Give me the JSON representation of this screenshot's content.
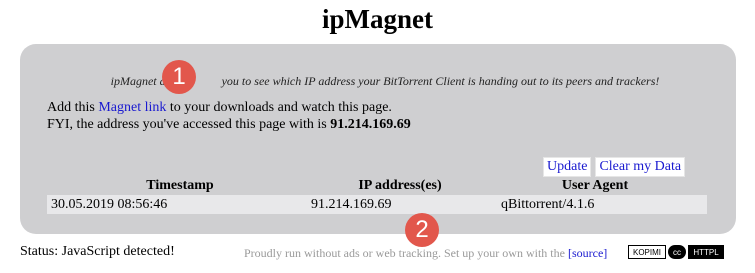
{
  "page": {
    "title": "ipMagnet",
    "tagline_left": "ipMagnet a",
    "tagline_right": "you to see which IP address your BitTorrent Client is handing out to its peers and trackers!",
    "add_prefix": "Add this ",
    "magnet_link": "Magnet link",
    "add_suffix": " to your downloads and watch this page.",
    "fyi_prefix": "FYI, the address you've accessed this page with is ",
    "fyi_ip": "91.214.169.69"
  },
  "buttons": {
    "update": "Update",
    "clear": "Clear my Data"
  },
  "table": {
    "headers": [
      "Timestamp",
      "IP address(es)",
      "User Agent"
    ],
    "rows": [
      [
        "30.05.2019 08:56:46",
        "91.214.169.69",
        "qBittorrent/4.1.6"
      ]
    ]
  },
  "markers": [
    "1",
    "2"
  ],
  "status": "Status: JavaScript detected!",
  "footer": {
    "text": "Proudly run without ads or web tracking. Set up your own with the ",
    "source": "[source]",
    "badge_kopimi": "KOPIMI",
    "badge_cc": "cc",
    "badge_httpl": "HTTPL"
  },
  "colors": {
    "panel": "#cfcfd1",
    "link": "#1a1ad0",
    "marker": "#e2574c"
  }
}
